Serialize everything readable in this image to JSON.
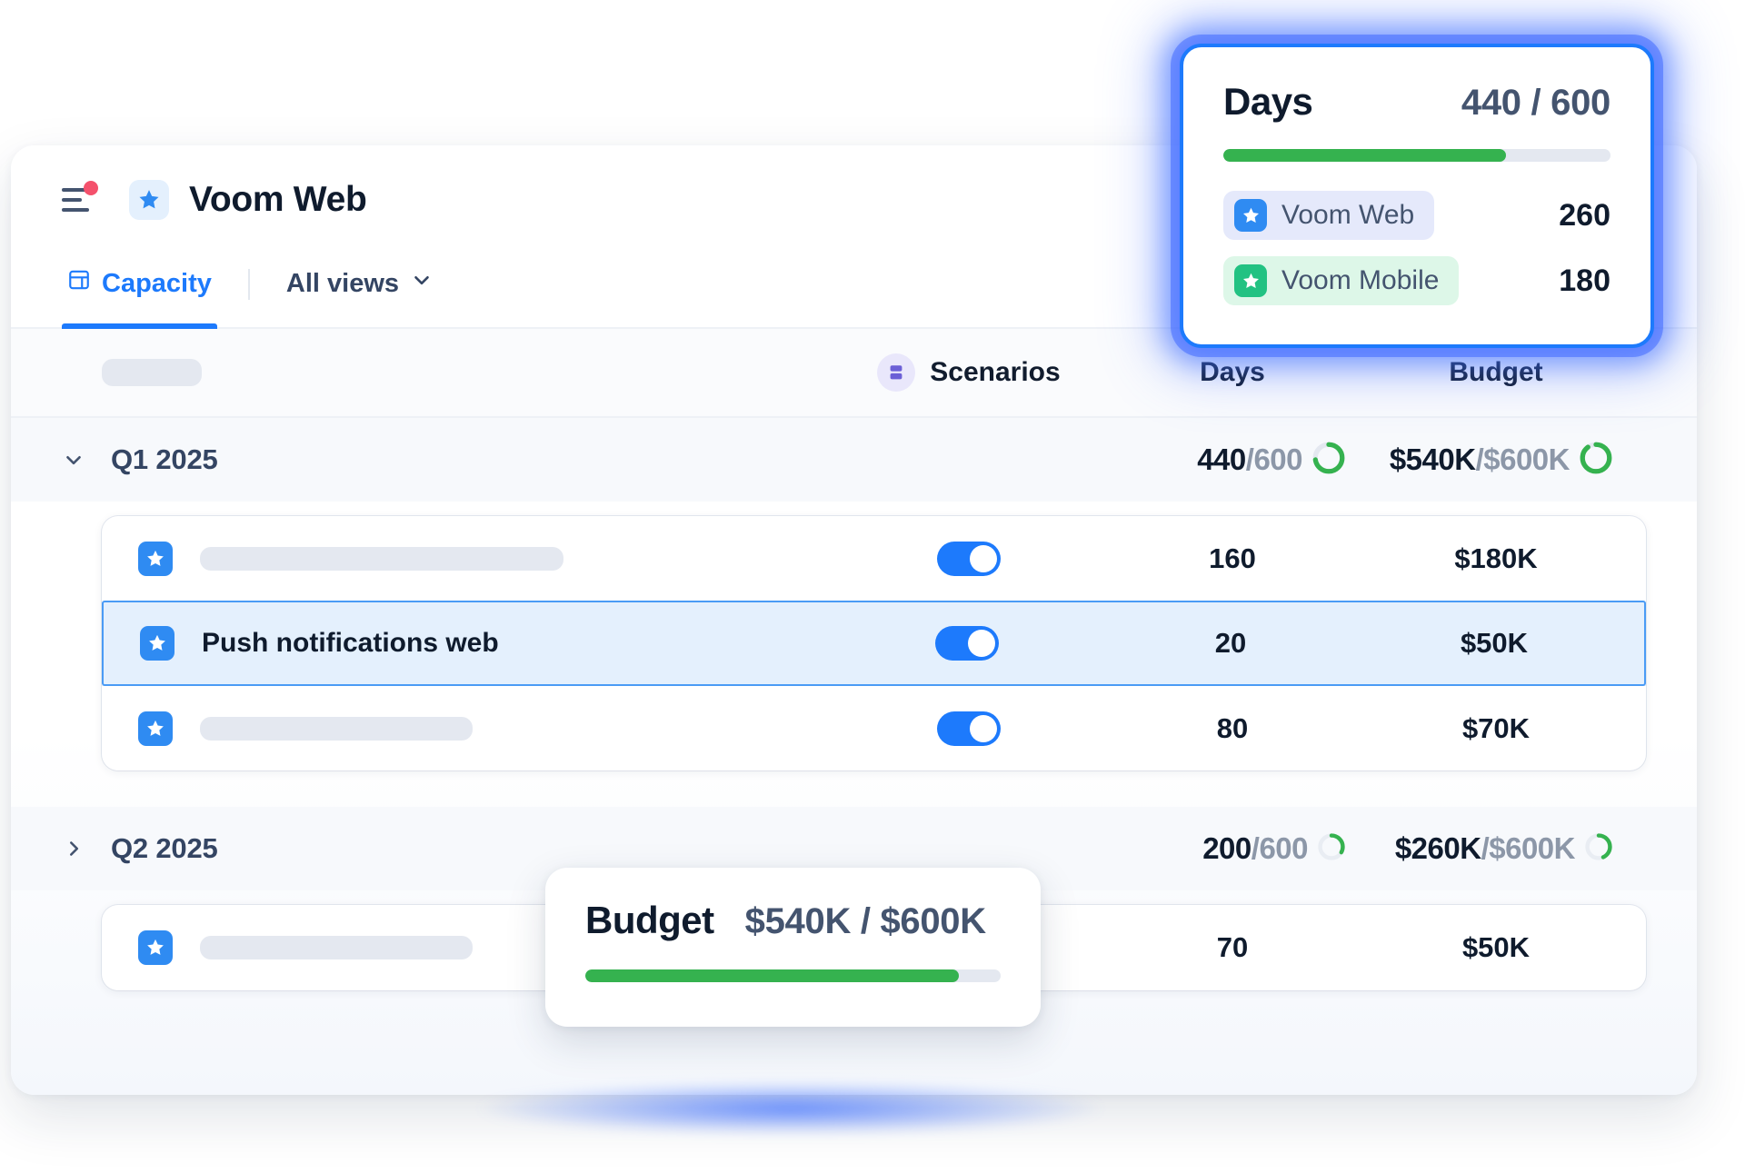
{
  "header": {
    "title": "Voom Web",
    "menu_icon": "hamburger-icon",
    "notification_dot": true,
    "project_icon": "star-icon"
  },
  "tabs": {
    "active": {
      "label": "Capacity",
      "icon": "table-icon"
    },
    "views": {
      "label": "All views",
      "icon": "chevron-down-icon"
    }
  },
  "table": {
    "columns": {
      "name": "",
      "scenarios": "Scenarios",
      "days": "Days",
      "budget": "Budget"
    },
    "groups": [
      {
        "name": "Q1 2025",
        "expanded": true,
        "caret": "chevron-down-icon",
        "days": {
          "used": "440",
          "sep": "/",
          "total": "600",
          "percent": 73
        },
        "budget": {
          "used": "$540K",
          "sep": "/",
          "total": "$600K",
          "percent": 90
        },
        "rows": [
          {
            "label": "",
            "placeholder": true,
            "toggle": true,
            "days": "160",
            "budget": "$180K",
            "selected": false
          },
          {
            "label": "Push notifications web",
            "placeholder": false,
            "toggle": true,
            "days": "20",
            "budget": "$50K",
            "selected": true
          },
          {
            "label": "",
            "placeholder": true,
            "toggle": true,
            "days": "80",
            "budget": "$70K",
            "selected": false
          }
        ]
      },
      {
        "name": "Q2 2025",
        "expanded": false,
        "caret": "chevron-right-icon",
        "days": {
          "used": "200",
          "sep": "/",
          "total": "600",
          "percent": 33
        },
        "budget": {
          "used": "$260K",
          "sep": "/",
          "total": "$600K",
          "percent": 43
        },
        "rows": [
          {
            "label": "",
            "placeholder": true,
            "toggle": false,
            "days": "70",
            "budget": "$50K",
            "selected": false
          }
        ]
      }
    ]
  },
  "days_card": {
    "title": "Days",
    "value": "440 / 600",
    "progress_percent": 73,
    "legend": [
      {
        "name": "Voom Web",
        "value": "260",
        "color": "#2f8bf2",
        "pill": "#e5e9fb"
      },
      {
        "name": "Voom Mobile",
        "value": "180",
        "color": "#22c282",
        "pill": "#ddf7e8"
      }
    ]
  },
  "budget_card": {
    "title": "Budget",
    "value": "$540K / $600K",
    "progress_percent": 90
  },
  "colors": {
    "accent_blue": "#1d7afc",
    "progress_green": "#35b24f",
    "mobile_green": "#22c282",
    "text_dark": "#0f1b2d",
    "text_muted": "#8c97a8"
  }
}
